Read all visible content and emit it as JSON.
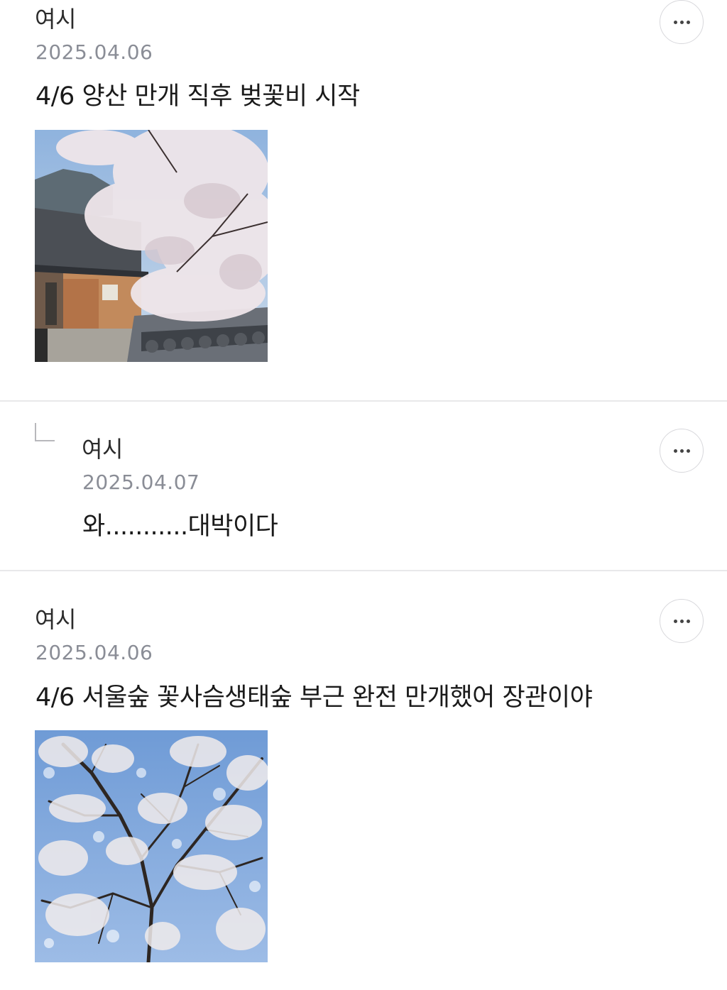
{
  "comments": [
    {
      "author": "여시",
      "date": "2025.04.06",
      "text": "4/6 양산 만개 직후 벚꽃비 시작",
      "photo_alt": "cherry blossoms over traditional Korean tiled roof building",
      "more_icon": "more-horizontal-icon"
    },
    {
      "author": "여시",
      "date": "2025.04.07",
      "text": "와...........대박이다",
      "is_reply": true,
      "reply_icon": "reply-corner-icon",
      "more_icon": "more-horizontal-icon"
    },
    {
      "author": "여시",
      "date": "2025.04.06",
      "text": "4/6 서울숲 꽃사슴생태숲 부근 완전 만개했어 장관이야",
      "photo_alt": "cherry blossom tree branches against blue sky",
      "more_icon": "more-horizontal-icon"
    }
  ],
  "colors": {
    "date": "#8a8d96",
    "divider": "#e8e8ea",
    "text": "#1a1a1a"
  }
}
